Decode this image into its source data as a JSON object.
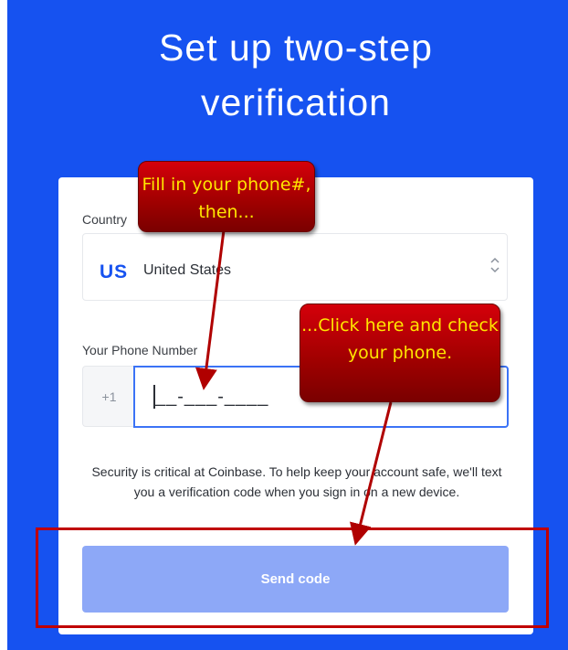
{
  "page": {
    "title_line1": "Set up two-step",
    "title_line2": "verification"
  },
  "form": {
    "country_label": "Country",
    "country_code": "US",
    "country_name": "United States",
    "phone_label": "Your Phone Number",
    "phone_prefix": "+1",
    "phone_placeholder": "__-___-____",
    "security_text": "Security is critical at Coinbase. To help keep your account safe, we'll text you a verification code when you sign in on a new device.",
    "send_button_label": "Send code"
  },
  "annotations": {
    "callout_1": "Fill in your phone#, then...",
    "callout_2": "...Click here and check your phone.",
    "highlight_color": "#c00000",
    "callout_text_color": "#ffe600"
  },
  "colors": {
    "brand_blue": "#1652f0",
    "button_disabled": "#8da8f7",
    "input_focus_border": "#3b73f6"
  },
  "icons": {
    "country_select_chevron": "chevron-up-down-icon"
  }
}
